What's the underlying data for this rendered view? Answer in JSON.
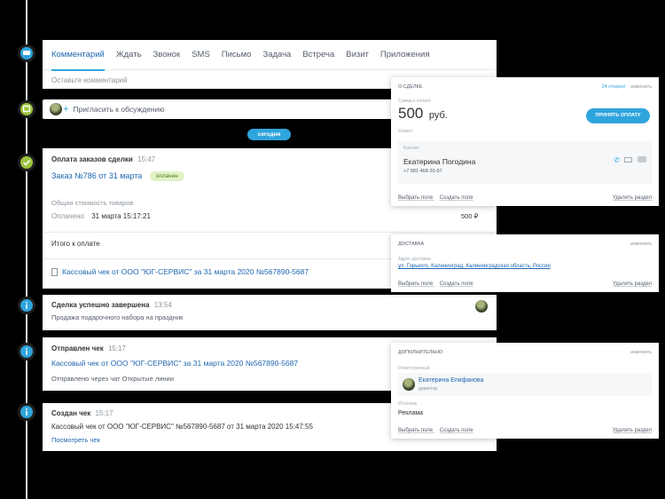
{
  "tabs": [
    "Комментарий",
    "Ждать",
    "Звонок",
    "SMS",
    "Письмо",
    "Задача",
    "Встреча",
    "Визит",
    "Приложения"
  ],
  "comment_placeholder": "Оставьте комментарий",
  "invite_label": "Пригласить к обсуждению",
  "today_label": "сегодня",
  "payment": {
    "title": "Оплата заказов сделки",
    "time": "15:47",
    "order_link": "Заказ №786 от 31 марта",
    "status": "оплачен",
    "goods_label": "Общая стоимость товаров",
    "paid_label": "Оплачено",
    "paid_date": "31 марта 15:17:21",
    "paid_amount": "500 ₽",
    "total_label": "Итого к оплате",
    "receipt_link": "Кассовый чек от ООО \"ЮГ-СЕРВИС\" за 31 марта 2020 №567890-5687"
  },
  "deal_done": {
    "title": "Сделка успешно завершена",
    "time": "13:54",
    "text": "Продажа подарочного набора на праздник"
  },
  "check_sent": {
    "title": "Отправлен чек",
    "time": "15:17",
    "link": "Кассовый чек от ООО \"ЮГ-СЕРВИС\" за 31 марта 2020 №567890-5687",
    "text": "Отправлено через чат Открытые линии"
  },
  "check_created": {
    "title": "Создан чек",
    "time": "15:17",
    "text": "Кассовый чек от ООО \"ЮГ-СЕРВИС\" №567890-5687 от 31 марта 2020 15:47:55",
    "link": "Посмотреть чек"
  },
  "about_deal": {
    "header": "О СДЕЛКЕ",
    "brand": "24 сторинг",
    "edit": "изменить",
    "sum_label": "Сумма к оплате",
    "amount": "500",
    "currency": "руб.",
    "pay_button": "ПРИНЯТЬ ОПЛАТУ",
    "client_label": "Клиент",
    "contact_label": "Контакт",
    "contact_name": "Екатерина Погодина",
    "contact_phone": "+7 981 468-30-97",
    "select_field": "Выбрать поле",
    "create_field": "Создать поле",
    "delete_section": "Удалить раздел"
  },
  "delivery": {
    "header": "ДОСТАВКА",
    "edit": "изменить",
    "address_label": "Адрес доставки",
    "address": "ул. Горького, Калининград, Калининградская область, Россия",
    "select_field": "Выбрать поле",
    "create_field": "Создать поле",
    "delete_section": "Удалить раздел"
  },
  "extra": {
    "header": "ДОПОЛНИТЕЛЬНО",
    "edit": "изменить",
    "responsible_label": "Ответственный",
    "responsible_name": "Екатерина Епифанова",
    "responsible_role": "директор",
    "source_label": "Источник",
    "source_value": "Реклама",
    "select_field": "Выбрать поле",
    "create_field": "Создать поле",
    "delete_section": "Удалить раздел"
  },
  "colors": {
    "accent": "#2fa5dd",
    "link": "#2067b0",
    "success": "#9bc43d"
  }
}
